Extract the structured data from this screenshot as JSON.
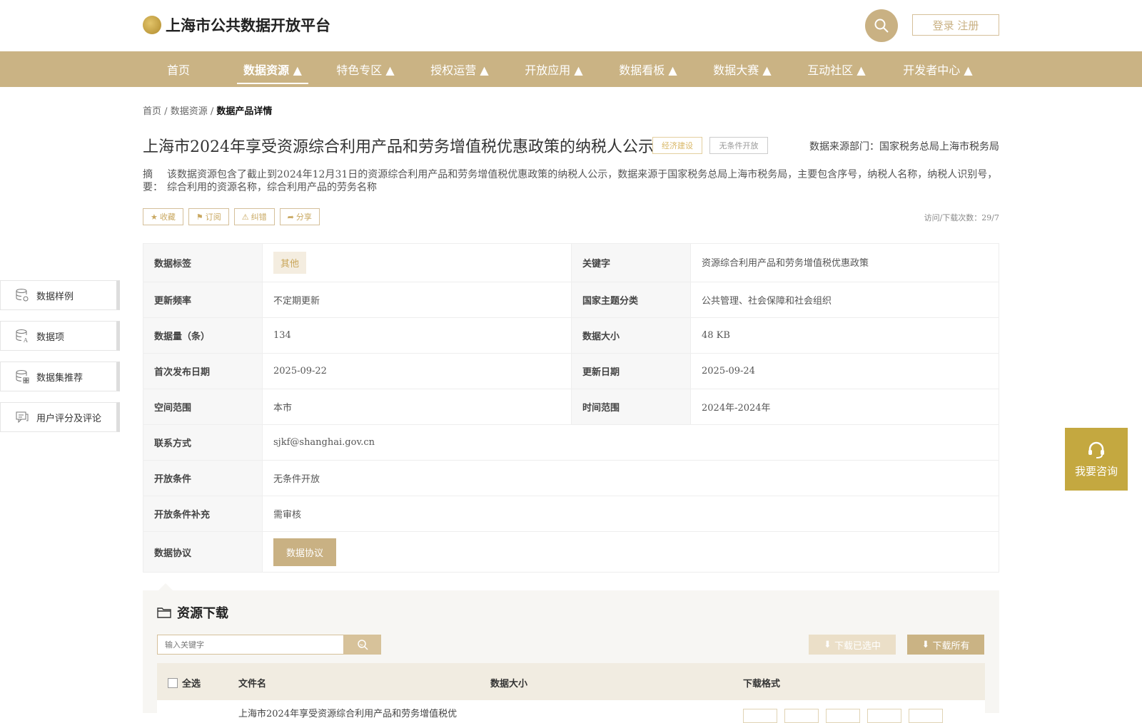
{
  "header": {
    "site_title": "上海市公共数据开放平台",
    "login_label": "登录 注册"
  },
  "nav": {
    "items": [
      {
        "label": "首页"
      },
      {
        "label": "数据资源 ▲"
      },
      {
        "label": "特色专区 ▲"
      },
      {
        "label": "授权运营 ▲"
      },
      {
        "label": "开放应用 ▲"
      },
      {
        "label": "数据看板 ▲"
      },
      {
        "label": "数据大赛 ▲"
      },
      {
        "label": "互动社区 ▲"
      },
      {
        "label": "开发者中心 ▲"
      }
    ],
    "active_index": 1
  },
  "breadcrumb": {
    "home": "首页",
    "sep": "/",
    "section": "数据资源",
    "current": "数据产品详情"
  },
  "product": {
    "title": "上海市2024年享受资源综合利用产品和劳务增值税优惠政策的纳税人公示",
    "tag_category": "经济建设",
    "tag_open": "无条件开放",
    "source": "数据来源部门：国家税务总局上海市税务局",
    "summary_label": "摘　要：",
    "summary": "该数据资源包含了截止到2024年12月31日的资源综合利用产品和劳务增值税优惠政策的纳税人公示，数据来源于国家税务总局上海市税务局，主要包含序号，纳税人名称，纳税人识别号，综合利用的资源名称，综合利用产品的劳务名称",
    "visits": "访问/下载次数：29/7"
  },
  "actions": {
    "favorite": "收藏",
    "subscribe": "订阅",
    "report": "纠错",
    "share": "分享"
  },
  "side": {
    "items": [
      {
        "label": "数据样例",
        "icon": "database-gear-icon"
      },
      {
        "label": "数据项",
        "icon": "database-text-icon"
      },
      {
        "label": "数据集推荐",
        "icon": "database-grid-icon"
      },
      {
        "label": "用户评分及评论",
        "icon": "comment-icon"
      }
    ]
  },
  "info": {
    "data_tag_label": "数据标签",
    "data_tag_value": "其他",
    "keyword_label": "关键字",
    "keyword_value": "资源综合利用产品和劳务增值税优惠政策",
    "freq_label": "更新频率",
    "freq_value": "不定期更新",
    "theme_label": "国家主题分类",
    "theme_value": "公共管理、社会保障和社会组织",
    "count_label": "数据量（条）",
    "count_value": "134",
    "size_label": "数据大小",
    "size_value": "48 KB",
    "first_pub_label": "首次发布日期",
    "first_pub_value": "2025-09-22",
    "update_label": "更新日期",
    "update_value": "2025-09-24",
    "space_label": "空间范围",
    "space_value": "本市",
    "time_label": "时间范围",
    "time_value": "2024年-2024年",
    "contact_label": "联系方式",
    "contact_value": "sjkf@shanghai.gov.cn",
    "open_cond_label": "开放条件",
    "open_cond_value": "无条件开放",
    "open_extra_label": "开放条件补充",
    "open_extra_value": "需审核",
    "agreement_label": "数据协议",
    "agreement_button": "数据协议"
  },
  "download": {
    "title": "资源下载",
    "search_placeholder": "输入关键字",
    "download_selected": "下载已选中",
    "download_all": "下载所有",
    "col_select_all": "全选",
    "col_filename": "文件名",
    "col_size": "数据大小",
    "col_format": "下载格式",
    "rows": [
      {
        "filename": "上海市2024年享受资源综合利用产品和劳务增值税优"
      }
    ]
  },
  "consult": {
    "label": "我要咨询"
  },
  "colors": {
    "brand_gold": "#cab384",
    "consult": "#c4a840"
  }
}
